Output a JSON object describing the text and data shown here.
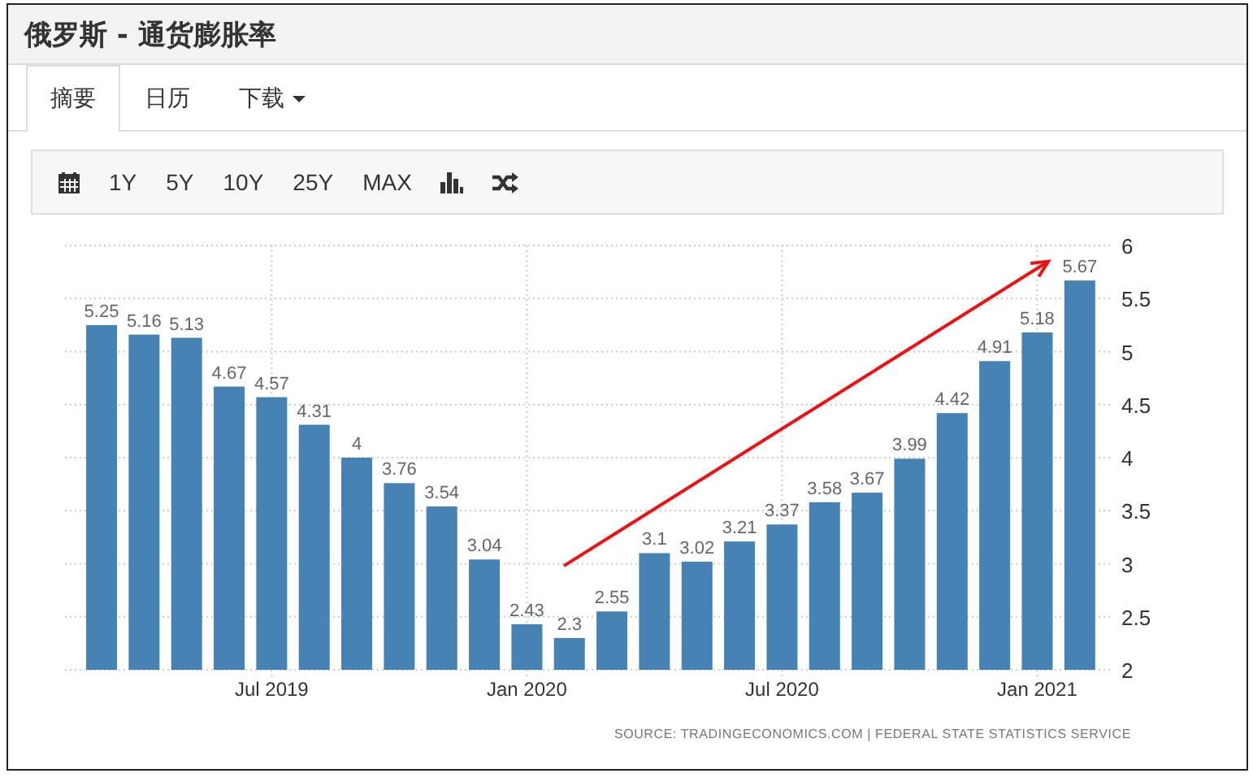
{
  "window": {
    "title": "俄罗斯 - 通货膨胀率"
  },
  "tabs": [
    {
      "label": "摘要",
      "selected": true
    },
    {
      "label": "日历",
      "selected": false
    },
    {
      "label": "下载",
      "selected": false,
      "dropdown": true
    }
  ],
  "toolbar": {
    "ranges": [
      "1Y",
      "5Y",
      "10Y",
      "25Y",
      "MAX"
    ]
  },
  "chart": {
    "chart_data": {
      "type": "bar",
      "values": [
        5.25,
        5.16,
        5.13,
        4.67,
        4.57,
        4.31,
        4,
        3.76,
        3.54,
        3.04,
        2.43,
        2.3,
        2.55,
        3.1,
        3.02,
        3.21,
        3.37,
        3.58,
        3.67,
        3.99,
        4.42,
        4.91,
        5.18,
        5.67
      ],
      "value_labels": [
        "5.25",
        "5.16",
        "5.13",
        "4.67",
        "4.57",
        "4.31",
        "4",
        "3.76",
        "3.54",
        "3.04",
        "2.43",
        "2.3",
        "2.55",
        "3.1",
        "3.02",
        "3.21",
        "3.37",
        "3.58",
        "3.67",
        "3.99",
        "4.42",
        "4.91",
        "5.18",
        "5.67"
      ],
      "categories": [
        null,
        null,
        null,
        null,
        "Jul 2019",
        null,
        null,
        null,
        null,
        null,
        "Jan 2020",
        null,
        null,
        null,
        null,
        null,
        "Jul 2020",
        null,
        null,
        null,
        null,
        null,
        "Jan 2021",
        null
      ],
      "grid": true,
      "ylim": [
        2,
        6
      ],
      "yticks": [
        2,
        {
          "value": 2.5,
          "label": "2.5"
        },
        3,
        {
          "value": 3.5,
          "label": "3.5"
        },
        4,
        {
          "value": 4.5,
          "label": "4.5"
        },
        5,
        {
          "value": 5.5,
          "label": "5.5"
        },
        6
      ]
    },
    "source": "SOURCE: TRADINGECONOMICS.COM | FEDERAL STATE STATISTICS SERVICE"
  }
}
